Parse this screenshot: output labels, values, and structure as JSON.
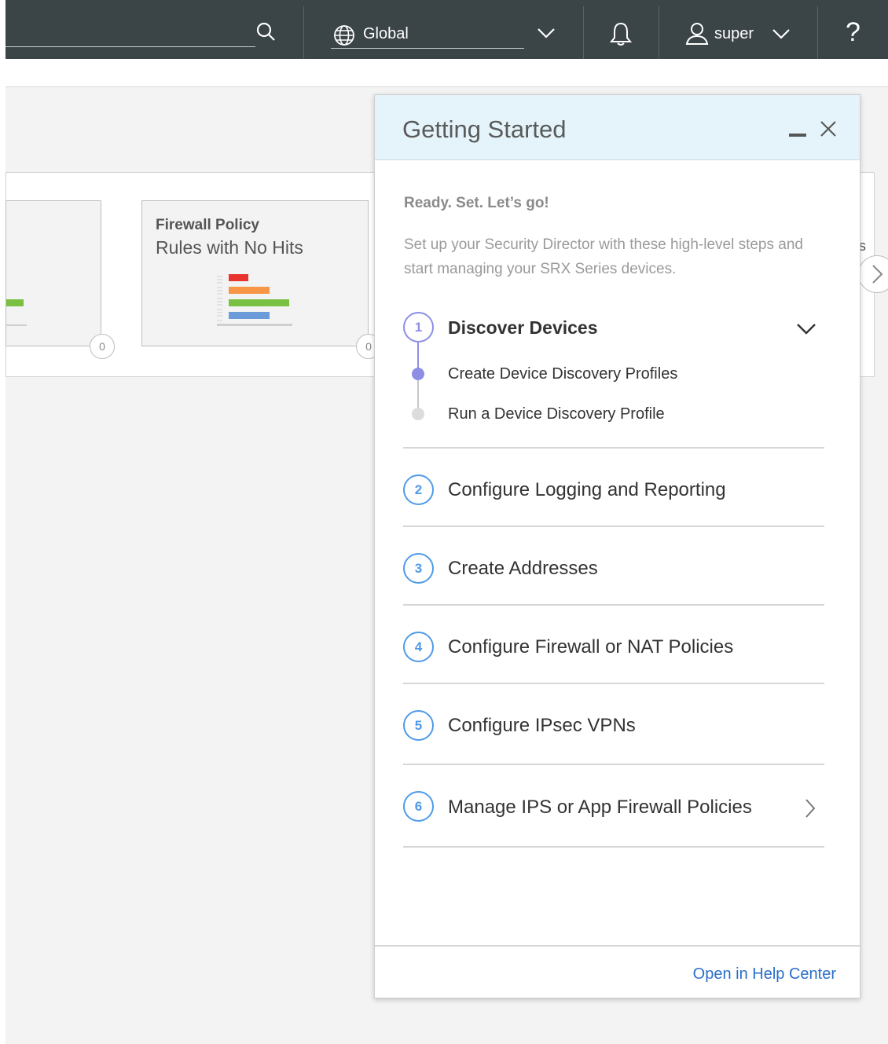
{
  "topbar": {
    "global_label": "Global",
    "user_label": "super",
    "help_label": "?",
    "icons": [
      "search-icon",
      "globe-icon",
      "chevron-down-icon",
      "bell-icon",
      "user-icon",
      "help-icon"
    ]
  },
  "dashboard": {
    "tile_firewall": {
      "title": "Firewall Policy",
      "subtitle": "Rules with No Hits",
      "count": "0"
    },
    "tile_left_count": "0",
    "right_tile_fragment": "s"
  },
  "panel": {
    "title": "Getting Started",
    "ready": "Ready. Set. Let’s go!",
    "intro": "Set up your Security Director with these high-level steps and start managing your SRX Series devices.",
    "steps": [
      {
        "number": "1",
        "label": "Discover Devices",
        "expanded": true,
        "substeps": [
          {
            "label": "Create Device Discovery Profiles",
            "state": "current"
          },
          {
            "label": "Run a Device Discovery Profile",
            "state": "pending"
          }
        ]
      },
      {
        "number": "2",
        "label": "Configure Logging and Reporting"
      },
      {
        "number": "3",
        "label": "Create Addresses"
      },
      {
        "number": "4",
        "label": "Configure Firewall or NAT Policies"
      },
      {
        "number": "5",
        "label": "Configure IPsec VPNs"
      },
      {
        "number": "6",
        "label": "Manage IPS or App Firewall Policies"
      }
    ],
    "footer_link": "Open in Help Center"
  },
  "colors": {
    "topbar_bg": "#3b4447",
    "panel_header_bg": "#e4f4fa",
    "step_circle": "#4e9be8",
    "active_step": "#8d8ee6",
    "link": "#2a6fc9",
    "chart_bars": [
      "#e8332e",
      "#f79646",
      "#7ac143",
      "#6b9bd8"
    ]
  }
}
